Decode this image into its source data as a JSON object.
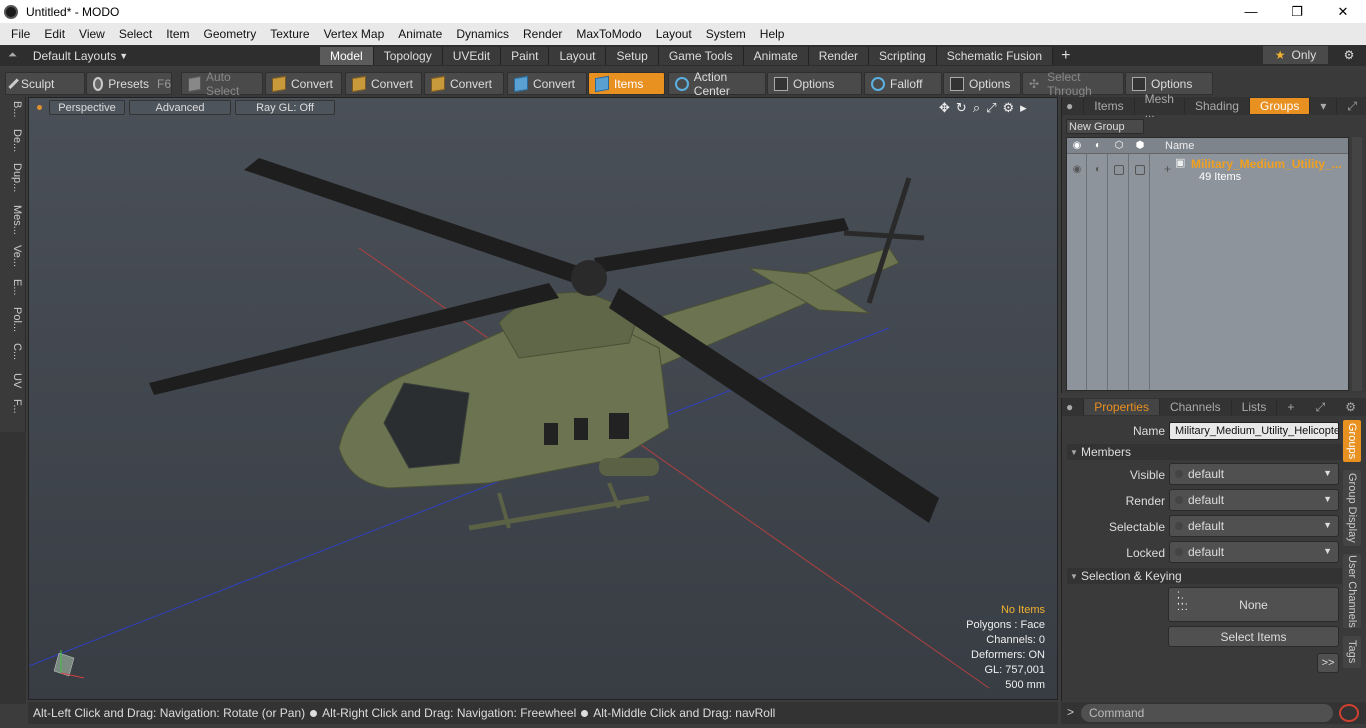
{
  "window": {
    "title": "Untitled* - MODO",
    "minimize": "—",
    "maximize": "❐",
    "close": "✕"
  },
  "menu": [
    "File",
    "Edit",
    "View",
    "Select",
    "Item",
    "Geometry",
    "Texture",
    "Vertex Map",
    "Animate",
    "Dynamics",
    "Render",
    "MaxToModo",
    "Layout",
    "System",
    "Help"
  ],
  "layouts": {
    "dropdown": "Default Layouts",
    "tabs": [
      "Model",
      "Topology",
      "UVEdit",
      "Paint",
      "Layout",
      "Setup",
      "Game Tools",
      "Animate",
      "Render",
      "Scripting",
      "Schematic Fusion"
    ],
    "active_tab": "Model",
    "only_label": "Only"
  },
  "toolbar": {
    "sculpt": "Sculpt",
    "presets": "Presets",
    "presets_shortcut": "F6",
    "auto_select": "Auto Select",
    "convert1": "Convert",
    "convert2": "Convert",
    "convert3": "Convert",
    "convert4": "Convert",
    "items": "Items",
    "action_center": "Action Center",
    "options1": "Options",
    "falloff": "Falloff",
    "options2": "Options",
    "select_through": "Select Through",
    "options3": "Options"
  },
  "left_tabs": [
    "B...",
    "De...",
    "Dup...",
    "Mes...",
    "Ve...",
    "E...",
    "Pol...",
    "C...",
    "UV",
    "F..."
  ],
  "viewport": {
    "view": "Perspective",
    "advanced": "Advanced",
    "raygl": "Ray GL: Off",
    "info": {
      "no_items": "No Items",
      "polygons": "Polygons : Face",
      "channels": "Channels: 0",
      "deformers": "Deformers: ON",
      "gl": "GL: 757,001",
      "scale": "500 mm"
    }
  },
  "status": {
    "hint1": "Alt-Left Click and Drag: Navigation: Rotate (or Pan)",
    "hint2": "Alt-Right Click and Drag: Navigation: Freewheel",
    "hint3": "Alt-Middle Click and Drag: navRoll"
  },
  "groups_panel": {
    "tabs": [
      "Items",
      "Mesh ...",
      "Shading",
      "Groups"
    ],
    "active_tab": "Groups",
    "new_group": "New Group",
    "column_name": "Name",
    "group_name": "Military_Medium_Utility_...",
    "group_count": "49 Items"
  },
  "properties_panel": {
    "tabs": [
      "Properties",
      "Channels",
      "Lists"
    ],
    "name_label": "Name",
    "name_value": "Military_Medium_Utility_Helicopter",
    "members_section": "Members",
    "visible_label": "Visible",
    "visible_value": "default",
    "render_label": "Render",
    "render_value": "default",
    "selectable_label": "Selectable",
    "selectable_value": "default",
    "locked_label": "Locked",
    "locked_value": "default",
    "selkey_section": "Selection & Keying",
    "none_label": "None",
    "select_items": "Select Items",
    "more": ">>",
    "side_tabs": [
      "Groups",
      "Group Display",
      "User Channels",
      "Tags"
    ]
  },
  "command": {
    "prompt": ">",
    "placeholder": "Command"
  },
  "colors": {
    "accent": "#e89020",
    "group_name": "#f0a020",
    "info_highlight": "#f0b030",
    "helicopter": "#6b7350"
  }
}
